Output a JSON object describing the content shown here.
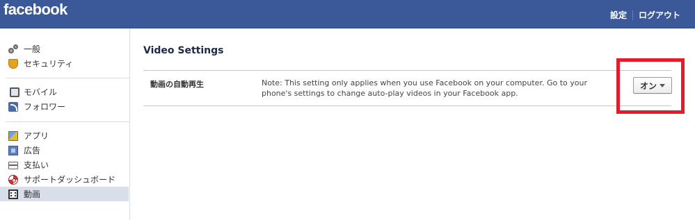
{
  "header": {
    "logo": "facebook",
    "links": [
      "設定",
      "ログアウト"
    ]
  },
  "sidebar": {
    "groups": [
      [
        {
          "label": "一般",
          "icon": "gear-icon"
        },
        {
          "label": "セキュリティ",
          "icon": "shield-icon"
        }
      ],
      [
        {
          "label": "モバイル",
          "icon": "phone-icon"
        },
        {
          "label": "フォロワー",
          "icon": "rss-icon"
        }
      ],
      [
        {
          "label": "アプリ",
          "icon": "app-box-icon"
        },
        {
          "label": "広告",
          "icon": "ad-icon"
        },
        {
          "label": "支払い",
          "icon": "credit-card-icon"
        },
        {
          "label": "サポートダッシュボード",
          "icon": "lifebuoy-icon"
        },
        {
          "label": "動画",
          "icon": "film-icon",
          "active": true
        }
      ]
    ]
  },
  "main": {
    "title": "Video Settings",
    "setting": {
      "label": "動画の自動再生",
      "note": "Note: This setting only applies when you use Facebook on your computer. Go to your phone's settings to change auto-play videos in your Facebook app.",
      "value": "オン"
    }
  },
  "colors": {
    "header_bg": "#3b5998",
    "active_item_bg": "#d8dfea",
    "highlight": "#e41b2a"
  }
}
